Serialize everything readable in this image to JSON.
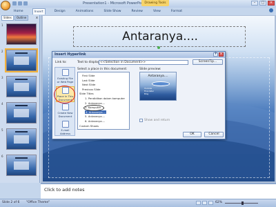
{
  "window": {
    "app_title": "Presentation1 - Microsoft PowerPoint",
    "context_tab": "Drawing Tools"
  },
  "ribbon": {
    "tabs": [
      "Home",
      "Insert",
      "Design",
      "Animations",
      "Slide Show",
      "Review",
      "View",
      "Format"
    ],
    "active_tab": "Insert"
  },
  "slides_pane": {
    "tabs": [
      "Slides",
      "Outline"
    ],
    "close": "x",
    "thumbs": [
      {
        "num": "1",
        "style": "sunset"
      },
      {
        "num": "2",
        "style": "blue",
        "selected": true
      },
      {
        "num": "3",
        "style": "blue"
      },
      {
        "num": "4",
        "style": "blue"
      },
      {
        "num": "5",
        "style": "blue"
      },
      {
        "num": "6",
        "style": "blue"
      }
    ]
  },
  "slide": {
    "title": "Antaranya...."
  },
  "dialog": {
    "title": "Insert Hyperlink",
    "link_to_label": "Link to:",
    "text_to_display_label": "Text to display:",
    "text_to_display_value": "<<Selection in Document>>",
    "screentip_label": "ScreenTip...",
    "select_place_label": "Select a place in this document:",
    "slide_preview_label": "Slide preview:",
    "link_options": [
      {
        "label": "Existing File or Web Page"
      },
      {
        "label": "Place in This Document",
        "selected": true
      },
      {
        "label": "Create New Document"
      },
      {
        "label": "E-mail Address"
      }
    ],
    "tree": [
      {
        "label": "First Slide",
        "indent": 1
      },
      {
        "label": "Last Slide",
        "indent": 1
      },
      {
        "label": "Next Slide",
        "indent": 1
      },
      {
        "label": "Previous Slide",
        "indent": 1
      },
      {
        "label": "Slide Titles",
        "indent": 0
      },
      {
        "label": "1. Pendidikan dalam komputer",
        "indent": 2
      },
      {
        "label": "2. Antaranya....",
        "indent": 2
      },
      {
        "label": "3. Komputer",
        "indent": 2
      },
      {
        "label": "4. Antaranya....",
        "indent": 2,
        "selected": true
      },
      {
        "label": "5. Antaranya....",
        "indent": 2
      },
      {
        "label": "6. Antaranya....",
        "indent": 2
      },
      {
        "label": "Custom Shows",
        "indent": 0
      }
    ],
    "preview": {
      "title": "Antaranya....",
      "lines": [
        "Youtube",
        "Friendster",
        "Blog"
      ]
    },
    "show_return_label": "Show and return",
    "ok_label": "OK",
    "cancel_label": "Cancel"
  },
  "notes": {
    "placeholder": "Click to add notes"
  },
  "status": {
    "slide_of": "Slide 2 of 6",
    "theme": "\"Office Theme\"",
    "zoom": "62%"
  },
  "colors": {
    "accent": "#3d6ab5",
    "title_bar": "#b9cde8",
    "slide_dark": "#173a72"
  }
}
